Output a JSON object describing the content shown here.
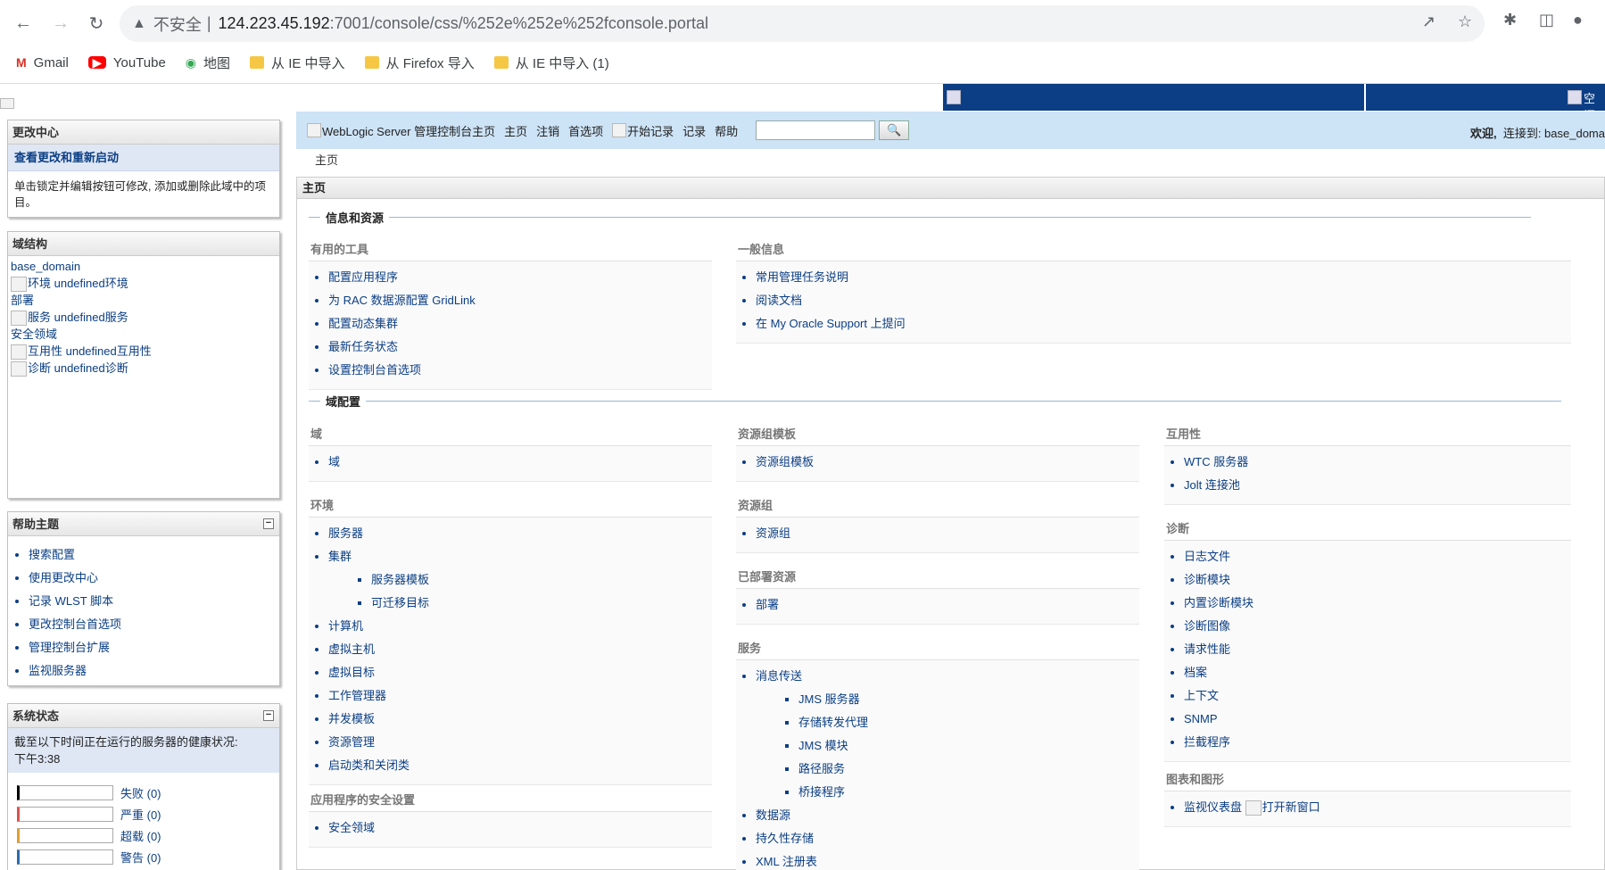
{
  "browser": {
    "omnibox": {
      "security_text": "不安全",
      "url_host": "124.223.45.192",
      "url_path": ":7001/console/css/%252e%252e%252fconsole.portal"
    },
    "bookmarks": [
      {
        "label": "Gmail",
        "icon": "gmail-icon"
      },
      {
        "label": "YouTube",
        "icon": "youtube-icon"
      },
      {
        "label": "地图",
        "icon": "maps-icon"
      },
      {
        "label": "从 IE 中导入",
        "icon": "folder-icon"
      },
      {
        "label": "从 Firefox 导入",
        "icon": "folder-icon"
      },
      {
        "label": "从 IE 中导入 (1)",
        "icon": "folder-icon"
      }
    ]
  },
  "banner": {
    "right_fragment": "空闲"
  },
  "change_center": {
    "title": "更改中心",
    "link": "查看更改和重新启动",
    "description": "单击锁定并编辑按钮可修改, 添加或删除此域中的项目。"
  },
  "domain_structure": {
    "title": "域结构",
    "root": "base_domain",
    "items": [
      "环境 undefined环境",
      "部署",
      "服务 undefined服务",
      "安全领域",
      "互用性 undefined互用性",
      "诊断 undefined诊断"
    ]
  },
  "help_topics": {
    "title": "帮助主题",
    "toggle": "−",
    "items": [
      "搜索配置",
      "使用更改中心",
      "记录 WLST 脚本",
      "更改控制台首选项",
      "管理控制台扩展",
      "监视服务器"
    ]
  },
  "system_status": {
    "title": "系统状态",
    "toggle": "−",
    "description": "截至以下时间正在运行的服务器的健康状况:",
    "time": "下午3:38",
    "rows": [
      {
        "label": "失败 (0)",
        "color": "#000000"
      },
      {
        "label": "严重 (0)",
        "color": "#d9534f"
      },
      {
        "label": "超载 (0)",
        "color": "#e0a030"
      },
      {
        "label": "警告 (0)",
        "color": "#2b6cb0"
      }
    ]
  },
  "topnav": {
    "home_alt": "WebLogic Server 管理控制台主页",
    "home": "主页",
    "logout": "注销",
    "preferences": "首选项",
    "record_alt": "开始记录",
    "record": "记录",
    "help": "帮助",
    "welcome": "欢迎,",
    "connected": "连接到: base_doma"
  },
  "breadcrumb": "主页",
  "content": {
    "title": "主页",
    "sections": {
      "info": "信息和资源",
      "domain_config": "域配置"
    },
    "useful_tools": {
      "title": "有用的工具",
      "items": [
        "配置应用程序",
        "为 RAC 数据源配置 GridLink",
        "配置动态集群",
        "最新任务状态",
        "设置控制台首选项"
      ]
    },
    "general_info": {
      "title": "一般信息",
      "items": [
        "常用管理任务说明",
        "阅读文档",
        "在 My Oracle Support 上提问"
      ]
    },
    "domain": {
      "title": "域",
      "items": [
        "域"
      ]
    },
    "environment": {
      "title": "环境",
      "items": [
        "服务器",
        "集群",
        "计算机",
        "虚拟主机",
        "虚拟目标",
        "工作管理器",
        "并发模板",
        "资源管理",
        "启动类和关闭类"
      ],
      "cluster_sub": [
        "服务器模板",
        "可迁移目标"
      ]
    },
    "app_security": {
      "title": "应用程序的安全设置",
      "items": [
        "安全领域"
      ]
    },
    "rg_templates": {
      "title": "资源组模板",
      "items": [
        "资源组模板"
      ]
    },
    "resource_groups": {
      "title": "资源组",
      "items": [
        "资源组"
      ]
    },
    "deployed": {
      "title": "已部署资源",
      "items": [
        "部署"
      ]
    },
    "services": {
      "title": "服务",
      "items": [
        "消息传送",
        "数据源",
        "持久性存储",
        "XML 注册表"
      ],
      "messaging_sub": [
        "JMS 服务器",
        "存储转发代理",
        "JMS 模块",
        "路径服务",
        "桥接程序"
      ]
    },
    "interop": {
      "title": "互用性",
      "items": [
        "WTC 服务器",
        "Jolt 连接池"
      ]
    },
    "diagnostics": {
      "title": "诊断",
      "items": [
        "日志文件",
        "诊断模块",
        "内置诊断模块",
        "诊断图像",
        "请求性能",
        "档案",
        "上下文",
        "SNMP",
        "拦截程序"
      ]
    },
    "charts": {
      "title": "图表和图形",
      "item": "监视仪表盘",
      "new_window_alt": "打开新窗口"
    }
  }
}
